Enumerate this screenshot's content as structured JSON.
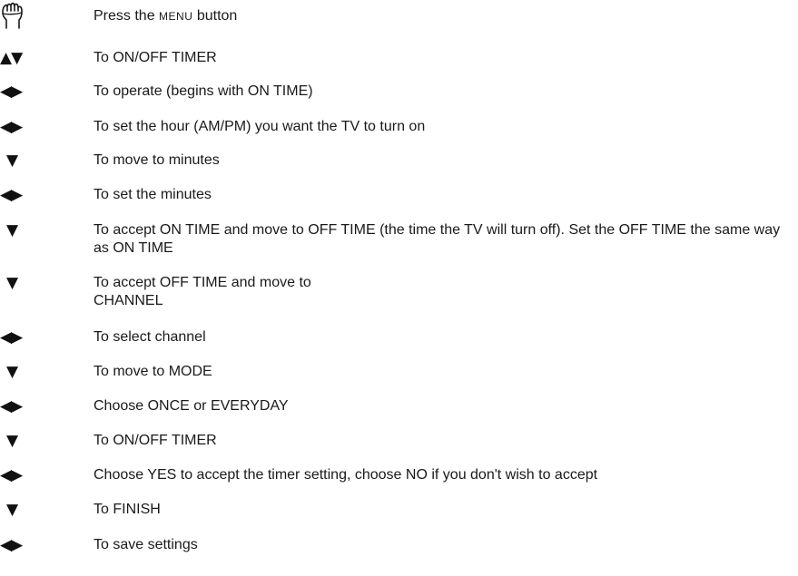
{
  "steps": [
    {
      "symbol": "hand-icon",
      "pre": "Press the ",
      "sc": "Menu",
      "post": " button"
    },
    {
      "symbol": "▲▼",
      "text": "To ON/OFF TIMER"
    },
    {
      "symbol": "◀▶",
      "text": "To operate (begins with ON TIME)"
    },
    {
      "symbol": "◀▶",
      "text": "To set the hour (AM/PM) you want the TV to turn on"
    },
    {
      "symbol": "▼",
      "text": "To move to minutes"
    },
    {
      "symbol": "◀▶",
      "text": "To set the minutes"
    },
    {
      "symbol": "▼",
      "text": "To accept ON TIME and move to OFF TIME (the time the TV will turn off). Set the OFF TIME the same way as ON TIME"
    },
    {
      "symbol": "▼",
      "text": "To accept OFF TIME and move to CHANNEL"
    },
    {
      "symbol": "◀▶",
      "text": "To select channel"
    },
    {
      "symbol": "▼",
      "text": "To move to MODE"
    },
    {
      "symbol": "◀▶",
      "text": "Choose ONCE or EVERYDAY"
    },
    {
      "symbol": "▼",
      "text": "To ON/OFF TIMER"
    },
    {
      "symbol": "◀▶",
      "text": "Choose YES to accept the timer setting, choose NO if you don't wish to accept"
    },
    {
      "symbol": "▼",
      "text": "To FINISH"
    },
    {
      "symbol": "◀▶",
      "text": "To save settings"
    }
  ]
}
